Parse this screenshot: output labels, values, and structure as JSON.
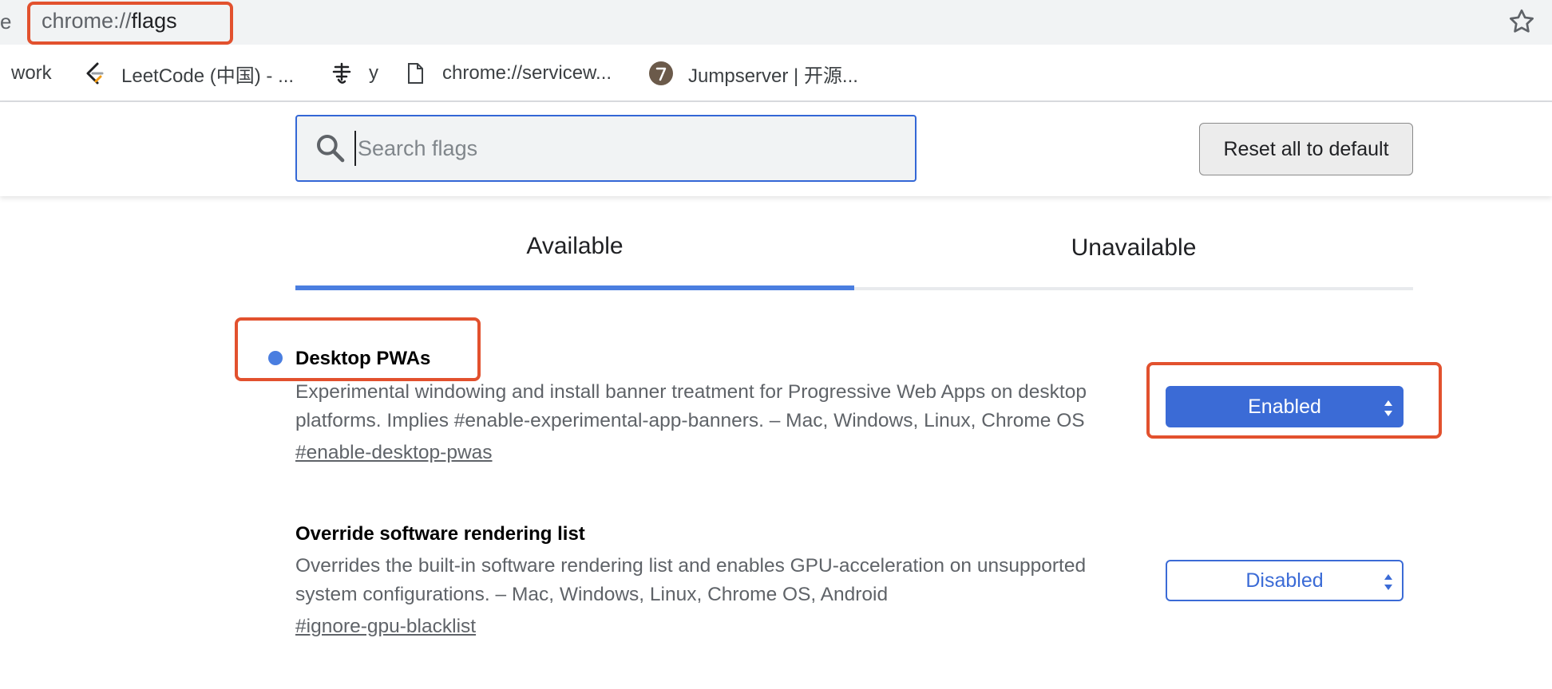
{
  "browser": {
    "omnibox_prefix": "e",
    "url_scheme": "chrome://",
    "url_path": "flags",
    "bookmark_icon": "star-icon"
  },
  "bookmarks": [
    {
      "label": "work",
      "icon": ""
    },
    {
      "label": "LeetCode (中国) - ...",
      "icon": "leetcode-icon"
    },
    {
      "label": "y",
      "icon": "calligraphy-icon"
    },
    {
      "label": "chrome://servicew...",
      "icon": "page-icon"
    },
    {
      "label": "Jumpserver | 开源...",
      "icon": "jumpserver-icon"
    }
  ],
  "header": {
    "search_placeholder": "Search flags",
    "search_value": "",
    "reset_label": "Reset all to default"
  },
  "tabs": [
    {
      "label": "Available",
      "active": true
    },
    {
      "label": "Unavailable",
      "active": false
    }
  ],
  "experiments": [
    {
      "title": "Desktop PWAs",
      "description": "Experimental windowing and install banner treatment for Progressive Web Apps on desktop platforms. Implies #enable-experimental-app-banners. – Mac, Windows, Linux, Chrome OS",
      "link": "#enable-desktop-pwas",
      "value": "Enabled",
      "modified": true
    },
    {
      "title": "Override software rendering list",
      "description": "Overrides the built-in software rendering list and enables GPU-acceleration on unsupported system configurations. – Mac, Windows, Linux, Chrome OS, Android",
      "link": "#ignore-gpu-blacklist",
      "value": "Disabled",
      "modified": false
    }
  ],
  "colors": {
    "accent": "#4a7ee0",
    "select_blue": "#3b6bd6",
    "annotation_red": "#e2512e",
    "description_gray": "#5f6368"
  }
}
